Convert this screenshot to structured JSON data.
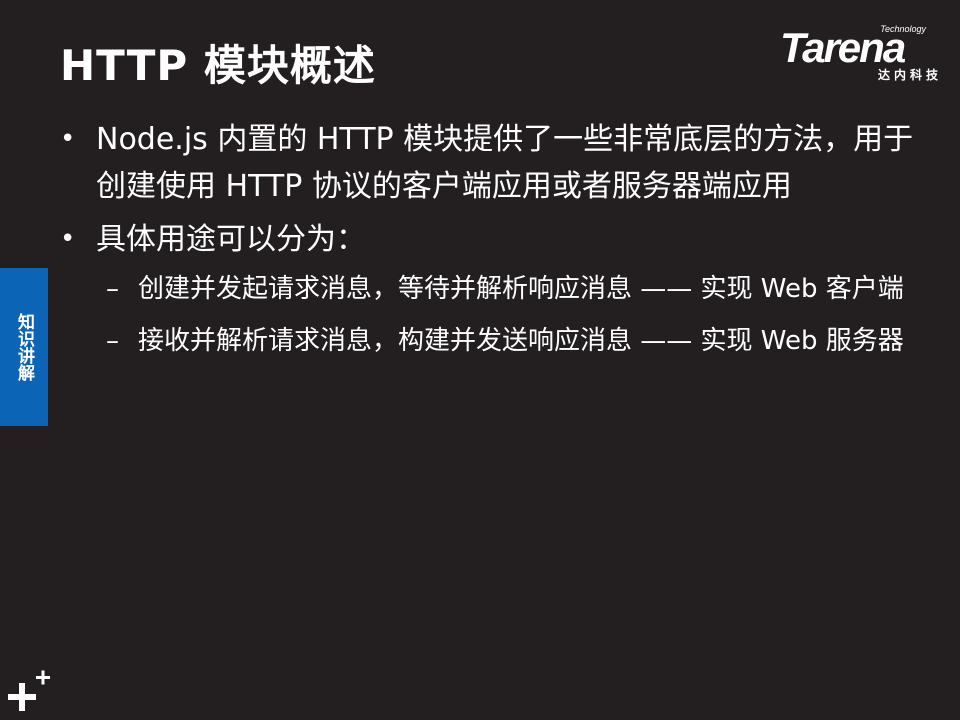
{
  "title": "HTTP 模块概述",
  "logo": {
    "tagline": "Technology",
    "word": "Tarena",
    "chinese": "达内科技"
  },
  "side_tab": {
    "label": "知识讲解",
    "color": "#0b64b6"
  },
  "bullets": [
    {
      "text": "Node.js 内置的 HTTP 模块提供了一些非常底层的方法，用于创建使用 HTTP 协议的客户端应用或者服务器端应用",
      "sub": []
    },
    {
      "text": "具体用途可以分为：",
      "sub": [
        "创建并发起请求消息，等待并解析响应消息 —— 实现 Web 客户端",
        "接收并解析请求消息，构建并发送响应消息 —— 实现 Web 服务器"
      ]
    }
  ],
  "bullet_symbol": "•",
  "dash_symbol": "–",
  "corner_icon": "plus-icon",
  "background_color": "#231f20"
}
